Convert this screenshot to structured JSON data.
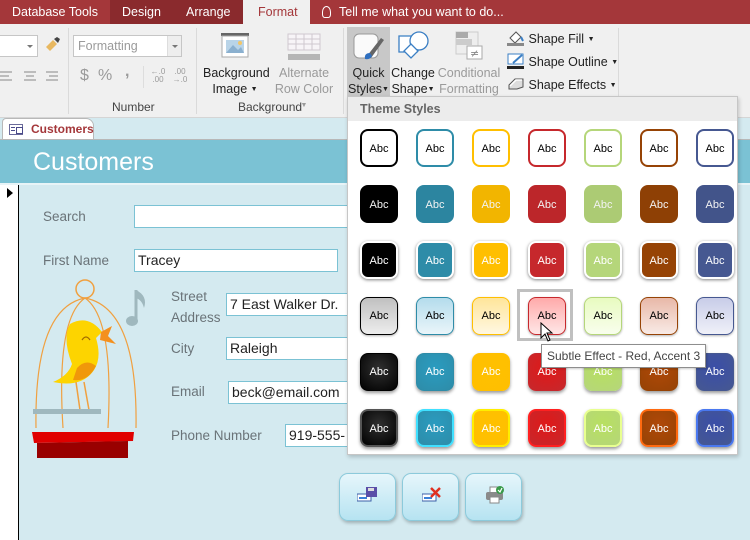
{
  "ribbon_tabs": [
    {
      "label": "Database Tools",
      "active": false
    },
    {
      "label": "Design",
      "active": false
    },
    {
      "label": "Arrange",
      "active": false
    },
    {
      "label": "Format",
      "active": true
    }
  ],
  "tell_me": "Tell me what you want to do...",
  "ribbon": {
    "number_group": {
      "format_combo": "Formatting",
      "currency_symbol": "$",
      "percent_symbol": "%",
      "comma_symbol": ",",
      "increase_decimals": "←.0 .00",
      "decrease_decimals": ".00 →.0",
      "label": "Number"
    },
    "background_group": {
      "background_image_line1": "Background",
      "background_image_line2": "Image",
      "alternate_row_line1": "Alternate",
      "alternate_row_line2": "Row Color",
      "label": "Background"
    },
    "control_formatting": {
      "quick_styles_line1": "Quick",
      "quick_styles_line2": "Styles",
      "change_shape_line1": "Change",
      "change_shape_line2": "Shape",
      "conditional_line1": "Conditional",
      "conditional_line2": "Formatting",
      "shape_fill": "Shape Fill",
      "shape_outline": "Shape Outline",
      "shape_effects": "Shape Effects"
    }
  },
  "document_tab": "Customers",
  "form": {
    "title": "Customers",
    "fields": {
      "search": {
        "label": "Search",
        "value": ""
      },
      "first_name": {
        "label": "First Name",
        "value": "Tracey"
      },
      "street_label_1": "Street",
      "street_label_2": "Address",
      "street_value": "7 East Walker Dr.",
      "city": {
        "label": "City",
        "value": "Raleigh"
      },
      "email": {
        "label": "Email",
        "value": "beck@email.com"
      },
      "phone": {
        "label": "Phone Number",
        "value": "919-555-"
      }
    },
    "buttons": [
      "save-record",
      "delete-record",
      "print-record"
    ]
  },
  "gallery": {
    "header": "Theme Styles",
    "swatch_text": "Abc",
    "accent_colors": [
      "#000000",
      "#2e8ca8",
      "#ffbf00",
      "#c6282c",
      "#b5d67a",
      "#964305",
      "#465891"
    ],
    "rows": [
      {
        "style": "outline"
      },
      {
        "style": "solid"
      },
      {
        "style": "solid-light-border"
      },
      {
        "style": "subtle"
      },
      {
        "style": "moderate"
      },
      {
        "style": "intense"
      }
    ],
    "selected": {
      "row": 3,
      "col": 3
    },
    "tooltip": "Subtle Effect - Red, Accent 3"
  }
}
